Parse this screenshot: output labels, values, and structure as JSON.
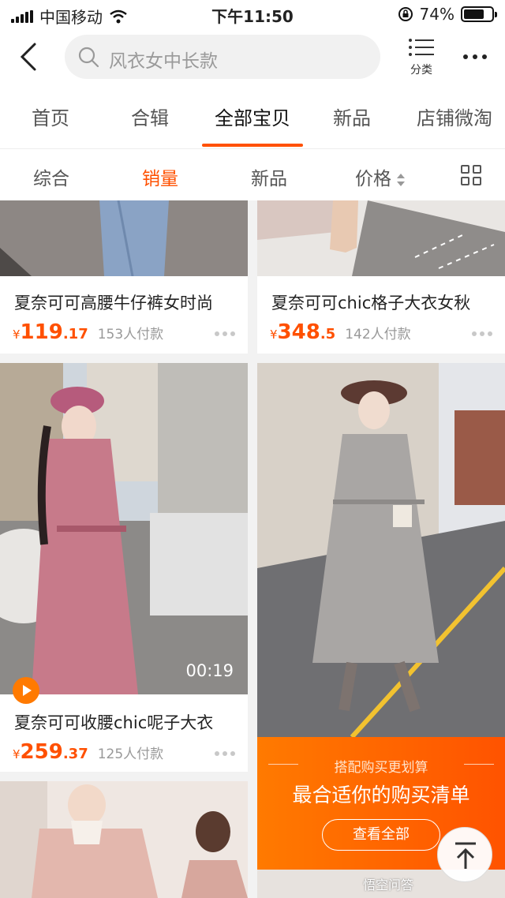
{
  "statusbar": {
    "carrier": "中国移动",
    "time": "下午11:50",
    "battery": "74%",
    "battery_level": 0.74
  },
  "header": {
    "search_placeholder": "风衣女中长款",
    "category_label": "分类"
  },
  "tabs": [
    "首页",
    "合辑",
    "全部宝贝",
    "新品",
    "店铺微淘"
  ],
  "active_tab": "全部宝贝",
  "sorts": [
    "综合",
    "销量",
    "新品",
    "价格"
  ],
  "active_sort": "销量",
  "products": [
    {
      "title": "夏奈可可高腰牛仔裤女时尚",
      "currency": "¥",
      "price_int": "119",
      "price_dec": ".17",
      "sold": "153人付款"
    },
    {
      "title": "夏奈可可chic格子大衣女秋",
      "currency": "¥",
      "price_int": "348",
      "price_dec": ".5",
      "sold": "142人付款"
    },
    {
      "title": "夏奈可可收腰chic呢子大衣",
      "currency": "¥",
      "price_int": "259",
      "price_dec": ".37",
      "sold": "125人付款",
      "video_time": "00:19"
    }
  ],
  "promo": {
    "subtitle": "搭配购买更划算",
    "title": "最合适你的购买清单",
    "button": "查看全部"
  },
  "watermark": "悟空问答",
  "colors": {
    "accent": "#ff5000",
    "promo_start": "#ff7a00",
    "promo_end": "#ff5300"
  }
}
